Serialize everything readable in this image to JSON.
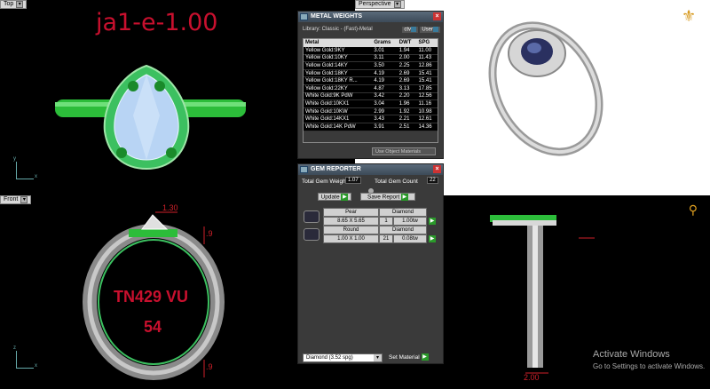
{
  "viewports": {
    "top": {
      "label": "Top",
      "model_text": "ja1-e-1.00",
      "axis_x": "x",
      "axis_y": "y"
    },
    "perspective": {
      "label": "Perspective"
    },
    "front": {
      "label": "Front",
      "engrave1": "TN429 VU",
      "engrave2": "54",
      "dim_top": "1.30",
      "dim_side": ".9",
      "dim_bottom": ".9",
      "axis_x": "x",
      "axis_y": "z"
    },
    "right": {
      "dim_bottom": "2.00"
    }
  },
  "metal_weights": {
    "title": "METAL WEIGHTS",
    "library": "Library: Classic - (Fast)-Metal",
    "tab_ctv": "ctv",
    "tab_user": "User",
    "headers": [
      "Metal",
      "Grams",
      "DWT",
      "SPG"
    ],
    "rows": [
      [
        "Yellow Gold:9KY",
        "3.01",
        "1.94",
        "11.00"
      ],
      [
        "Yellow Gold:10KY",
        "3.11",
        "2.00",
        "11.43"
      ],
      [
        "Yellow Gold:14KY",
        "3.50",
        "2.25",
        "12.86"
      ],
      [
        "Yellow Gold:18KY",
        "4.19",
        "2.69",
        "15.41"
      ],
      [
        "Yellow Gold:18KY R...",
        "4.19",
        "2.69",
        "15.41"
      ],
      [
        "Yellow Gold:22KY",
        "4.87",
        "3.13",
        "17.85"
      ],
      [
        "White Gold:9K PdW",
        "3.42",
        "2.20",
        "12.56"
      ],
      [
        "White Gold:10KX1",
        "3.04",
        "1.96",
        "11.16"
      ],
      [
        "White Gold:10KW",
        "2.99",
        "1.92",
        "10.98"
      ],
      [
        "White Gold:14KX1",
        "3.43",
        "2.21",
        "12.61"
      ],
      [
        "White Gold:14K PdW",
        "3.91",
        "2.51",
        "14.36"
      ]
    ],
    "use_object_materials": "Use Object Materials"
  },
  "gem_reporter": {
    "title": "GEM REPORTER",
    "total_weight_label": "Total Gem Weight",
    "total_weight": "1.07",
    "total_count_label": "Total Gem Count",
    "total_count": "22",
    "update": "Update",
    "save_report": "Save Report",
    "gems": [
      {
        "shape": "Pear",
        "size": "8.65 X 5.65",
        "type": "Diamond",
        "count": "1",
        "weight": "1.00tw"
      },
      {
        "shape": "Round",
        "size": "1.00 X 1.00",
        "type": "Diamond",
        "count": "21",
        "weight": "0.08tw"
      }
    ],
    "material_select": "Diamond    (3.52 spg)",
    "set_material": "Set Material"
  },
  "watermark": {
    "title": "Activate Windows",
    "subtitle": "Go to Settings to activate Windows."
  }
}
